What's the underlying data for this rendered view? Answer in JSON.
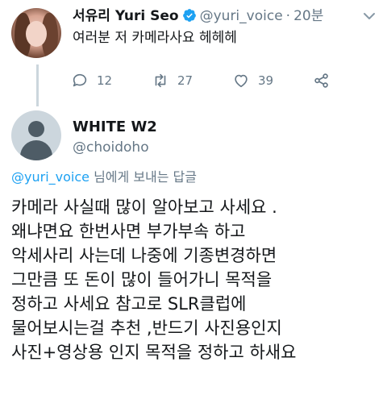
{
  "original_tweet": {
    "display_name": "서유리 Yuri Seo",
    "handle": "@yuri_voice",
    "separator": "·",
    "time": "20분",
    "text": "여러분 저 카메라사요 헤헤헤",
    "verified": true,
    "actions": {
      "reply_count": "12",
      "retweet_count": "27",
      "like_count": "39"
    },
    "icons": [
      "reply-icon",
      "retweet-icon",
      "like-icon",
      "share-icon",
      "caret-down-icon",
      "verified-badge-icon"
    ]
  },
  "reply_tweet": {
    "display_name": "WHITE W2",
    "handle": "@choidoho",
    "replying_to_mention": "@yuri_voice",
    "replying_to_suffix": " 님에게 보내는 답글",
    "lines": [
      "카메라 사실때 많이 알아보고 사세요 .",
      "왜냐면요 한번사면 부가부속 하고",
      "악세사리 사는데 나중에 기종변경하면",
      "그만큼 또 돈이 많이 들어가니 목적을",
      "정하고 사세요  참고로  SLR클럽에",
      "물어보시는걸 추천 ,반드기 사진용인지",
      "사진+영상용 인지 목적을 정하고 하새요"
    ]
  },
  "colors": {
    "accent": "#1da1f2",
    "secondary_text": "#657786",
    "primary_text": "#14171a",
    "thread_line": "#ccd6dd"
  }
}
